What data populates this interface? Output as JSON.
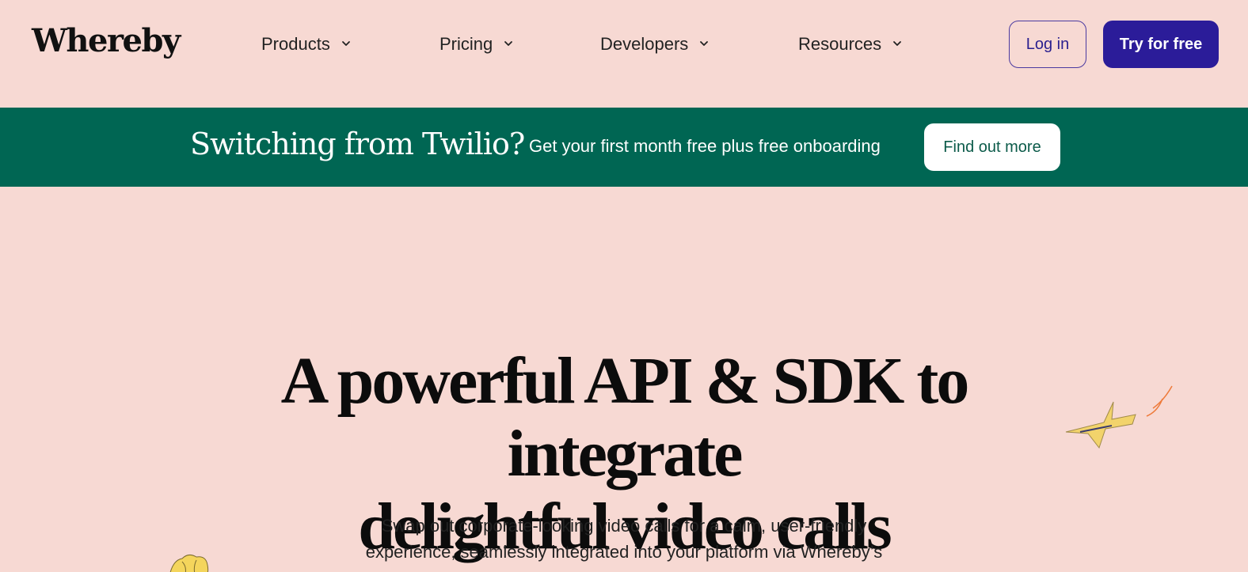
{
  "header": {
    "logo": "Whereby",
    "nav": [
      {
        "label": "Products"
      },
      {
        "label": "Pricing"
      },
      {
        "label": "Developers"
      },
      {
        "label": "Resources"
      }
    ],
    "login_label": "Log in",
    "try_label": "Try for free"
  },
  "banner": {
    "title": "Switching from Twilio?",
    "text": "Get your first month free plus free onboarding",
    "button_label": "Find out more"
  },
  "hero": {
    "title_line1": "A powerful API & SDK to integrate",
    "title_line2": "delightful video calls",
    "subtitle_line1": "Swap out corporate-looking video calls for a calm, user-friendly",
    "subtitle_line2": "experience, seamlessly integrated into your platform via Whereby’s"
  },
  "colors": {
    "background": "#f7d9d3",
    "banner": "#006653",
    "primary": "#2b1c99"
  },
  "icons": {
    "nav_chevron": "chevron-down-icon",
    "plane_illustration": "paper-plane-illustration",
    "flower_illustration": "flower-illustration"
  }
}
